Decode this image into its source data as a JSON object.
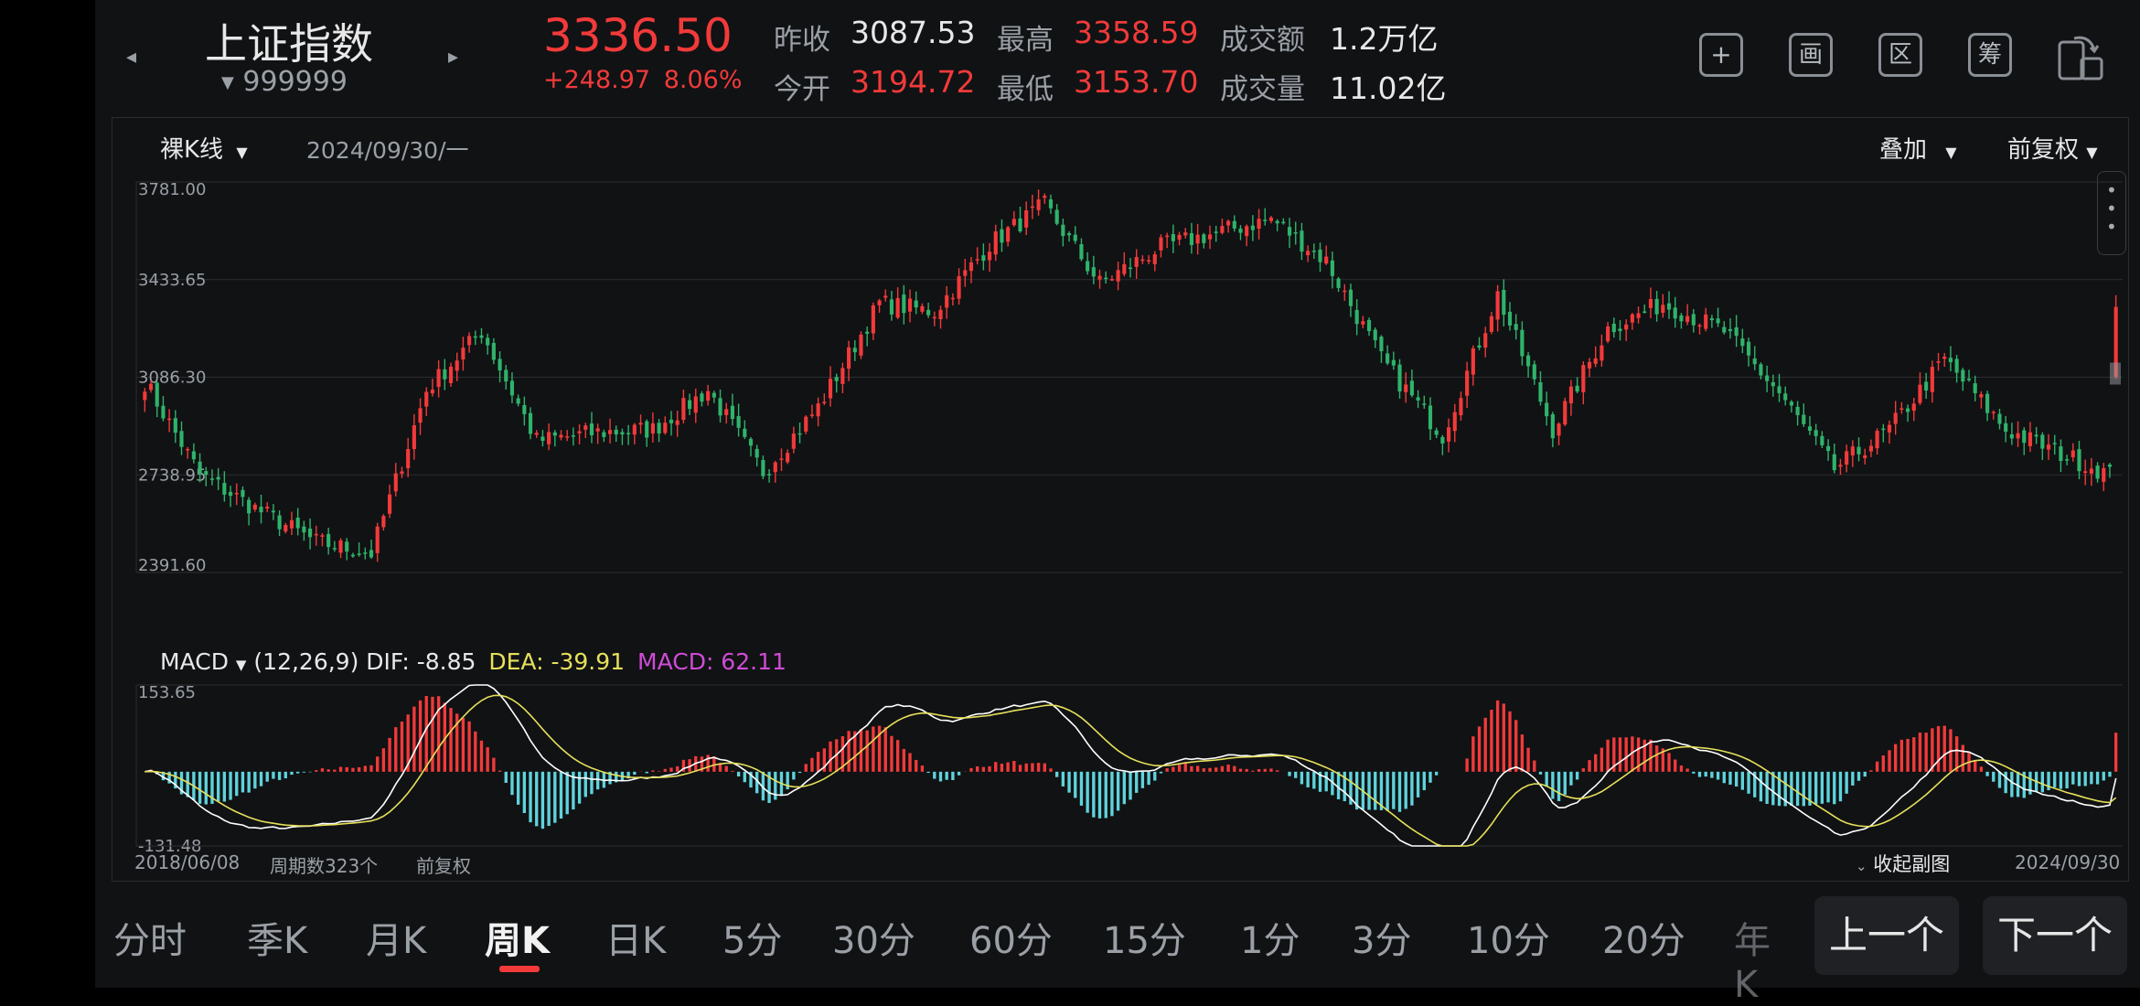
{
  "header": {
    "index_name": "上证指数",
    "index_code": "999999",
    "price": "3336.50",
    "change": "+248.97",
    "change_pct": "8.06%",
    "stats": [
      {
        "label": "昨收",
        "value": "3087.53",
        "color": "white"
      },
      {
        "label": "今开",
        "value": "3194.72",
        "color": "red"
      },
      {
        "label": "最高",
        "value": "3358.59",
        "color": "red"
      },
      {
        "label": "最低",
        "value": "3153.70",
        "color": "red"
      },
      {
        "label": "成交额",
        "value": "1.2万亿",
        "color": "white"
      },
      {
        "label": "成交量",
        "value": "11.02亿",
        "color": "white"
      }
    ],
    "tools": [
      {
        "icon": "add-icon",
        "glyph": "+"
      },
      {
        "icon": "draw-icon",
        "glyph": "画"
      },
      {
        "icon": "range-icon",
        "glyph": "区"
      },
      {
        "icon": "chips-icon",
        "glyph": "筹"
      },
      {
        "icon": "rotate-screen-icon",
        "glyph": ""
      }
    ]
  },
  "chart_bar": {
    "kline_type": "裸K线",
    "date": "2024/09/30/一",
    "overlay": "叠加",
    "adjust": "前复权"
  },
  "macd": {
    "label": "MACD",
    "params": "(12,26,9)",
    "dif": "DIF: -8.85",
    "dea": "DEA: -39.91",
    "macd": "MACD: 62.11"
  },
  "footer": {
    "start_date": "2018/06/08",
    "period_count": "周期数323个",
    "adjust": "前复权",
    "collapse": "收起副图",
    "end_date": "2024/09/30"
  },
  "tabs": [
    "分时",
    "季K",
    "月K",
    "周K",
    "日K",
    "5分",
    "30分",
    "60分",
    "15分",
    "1分",
    "3分",
    "10分",
    "20分",
    "年K"
  ],
  "active_tab": "周K",
  "buttons": {
    "prev": "上一个",
    "next": "下一个"
  },
  "colors": {
    "up": "#f23a3a",
    "down": "#2fb36b",
    "dif": "#ffffff",
    "dea": "#e6e05a",
    "macd_label": "#d04bd6",
    "hist_down": "#5fd3dc"
  },
  "chart_data": [
    {
      "type": "candlestick",
      "title": "上证指数 周K",
      "y_ticks": [
        "3781.00",
        "3433.65",
        "3086.30",
        "2738.95",
        "2391.60"
      ],
      "ylim": [
        2391.6,
        3781.0
      ],
      "x_start": "2018/06/08",
      "x_end": "2024/09/30",
      "periods": 323,
      "close_path": [
        [
          "2018/06",
          3070
        ],
        [
          "2018/08",
          2740
        ],
        [
          "2018/10",
          2620
        ],
        [
          "2018/12",
          2500
        ],
        [
          "2019/01",
          2460
        ],
        [
          "2019/03",
          3040
        ],
        [
          "2019/04",
          3250
        ],
        [
          "2019/05",
          2860
        ],
        [
          "2019/08",
          2890
        ],
        [
          "2019/11",
          2900
        ],
        [
          "2020/01",
          3040
        ],
        [
          "2020/03",
          2750
        ],
        [
          "2020/06",
          2980
        ],
        [
          "2020/07",
          3350
        ],
        [
          "2020/10",
          3320
        ],
        [
          "2021/01",
          3560
        ],
        [
          "2021/02",
          3700
        ],
        [
          "2021/03",
          3420
        ],
        [
          "2021/07",
          3550
        ],
        [
          "2021/09",
          3600
        ],
        [
          "2021/12",
          3650
        ],
        [
          "2022/01",
          3500
        ],
        [
          "2022/03",
          3150
        ],
        [
          "2022/04",
          2880
        ],
        [
          "2022/07",
          3380
        ],
        [
          "2022/10",
          2900
        ],
        [
          "2023/01",
          3260
        ],
        [
          "2023/04",
          3350
        ],
        [
          "2023/07",
          3250
        ],
        [
          "2023/10",
          3030
        ],
        [
          "2024/01",
          2760
        ],
        [
          "2024/02",
          2900
        ],
        [
          "2024/05",
          3150
        ],
        [
          "2024/07",
          2900
        ],
        [
          "2024/09/20",
          2740
        ],
        [
          "2024/09/30",
          3336.5
        ]
      ]
    },
    {
      "type": "macd",
      "title": "MACD(12,26,9)",
      "y_ticks": [
        "153.65",
        "-131.48"
      ],
      "ylim": [
        -131.48,
        153.65
      ],
      "last": {
        "dif": -8.85,
        "dea": -39.91,
        "macd": 62.11
      }
    }
  ]
}
